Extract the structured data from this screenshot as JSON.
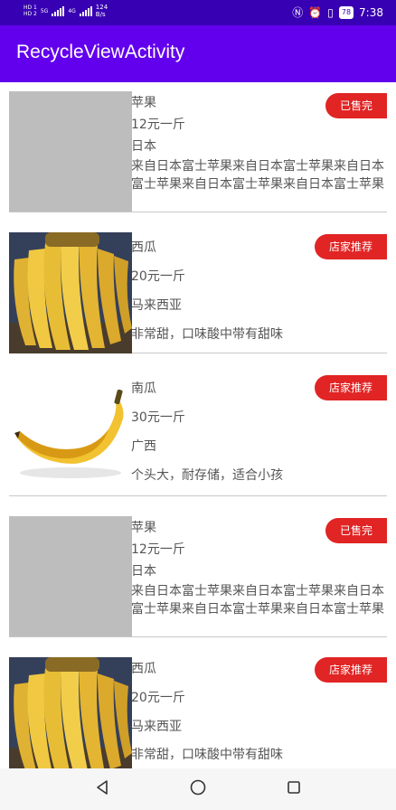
{
  "status_bar": {
    "sim1": "HD 1",
    "sim2": "HD 2",
    "net1": "5G",
    "net2": "4G",
    "speed_value": "124",
    "speed_unit": "B/s",
    "battery": "78",
    "time": "7:38"
  },
  "app_bar": {
    "title": "RecycleViewActivity"
  },
  "items": [
    {
      "name": "苹果",
      "price": "12元一斤",
      "origin": "日本",
      "desc": "来自日本富士苹果来自日本富士苹果来自日本富士苹果来自日本富士苹果来自日本富士苹果",
      "badge": "已售完",
      "image": "gray-placeholder"
    },
    {
      "name": "西瓜",
      "price": "20元一斤",
      "origin": "马来西亚",
      "desc": "非常甜，口味酸中带有甜味",
      "badge": "店家推荐",
      "image": "banana-bunch"
    },
    {
      "name": "南瓜",
      "price": "30元一斤",
      "origin": "广西",
      "desc": "个头大，耐存储，适合小孩",
      "badge": "店家推荐",
      "image": "single-banana"
    },
    {
      "name": "苹果",
      "price": "12元一斤",
      "origin": "日本",
      "desc": "来自日本富士苹果来自日本富士苹果来自日本富士苹果来自日本富士苹果来自日本富士苹果",
      "badge": "已售完",
      "image": "gray-placeholder"
    },
    {
      "name": "西瓜",
      "price": "20元一斤",
      "origin": "马来西亚",
      "desc": "非常甜，口味酸中带有甜味",
      "badge": "店家推荐",
      "image": "banana-bunch"
    }
  ],
  "nav_bar": {
    "back": "back-icon",
    "home": "home-icon",
    "recents": "recents-icon"
  },
  "colors": {
    "status_bar": "#3700b3",
    "app_bar": "#6200ee",
    "badge": "#e12424",
    "placeholder": "#bdbdbd"
  }
}
